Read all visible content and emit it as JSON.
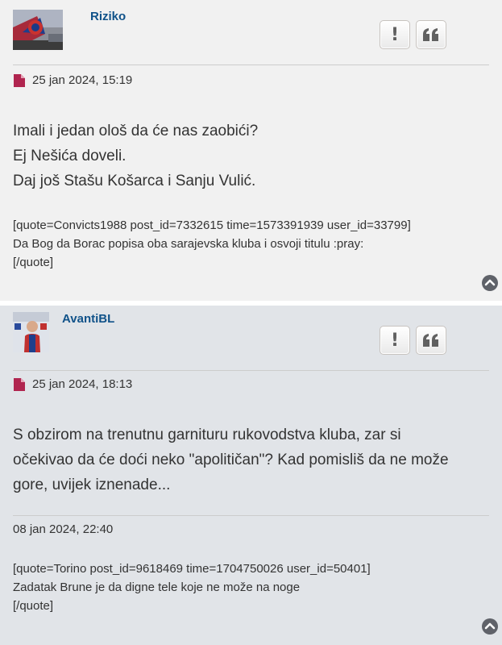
{
  "posts": [
    {
      "author": "Riziko",
      "date": "25 jan 2024, 15:19",
      "body_lines": [
        "Imali i jedan ološ da će nas zaobići?",
        "Ej Nešića doveli.",
        "Daj još Stašu Košarca i Sanju Vulić."
      ],
      "quote_lines": [
        "[quote=Convicts1988 post_id=7332615 time=1573391939 user_id=33799]",
        "Da Bog da Borac popisa oba sarajevska kluba i osvoji titulu :pray:",
        "[/quote]"
      ],
      "buttons": {
        "report": "!",
        "quote": "❝"
      }
    },
    {
      "author": "AvantiBL",
      "date": "25 jan 2024, 18:13",
      "body_lines": [
        "S obzirom na trenutnu garnituru rukovodstva kluba, zar si",
        "očekivao da će doći neko \"apolitičan\"? Kad pomisliš da ne može",
        "gore, uvijek iznenade..."
      ],
      "edit_date": "08 jan 2024, 22:40",
      "quote_lines": [
        "[quote=Torino post_id=9618469 time=1704750026 user_id=50401]",
        "Zadatak Brune je da digne tele koje ne može na noge",
        "[/quote]"
      ],
      "buttons": {
        "report": "!",
        "quote": "❝"
      }
    }
  ],
  "colors": {
    "username": "#105289",
    "post_icon": "#b0254f",
    "post1_bg": "#f1f1f1",
    "post2_bg": "#e1e4e8"
  },
  "icons": [
    "file-icon",
    "exclamation-icon",
    "quote-icon",
    "back-to-top-icon"
  ]
}
